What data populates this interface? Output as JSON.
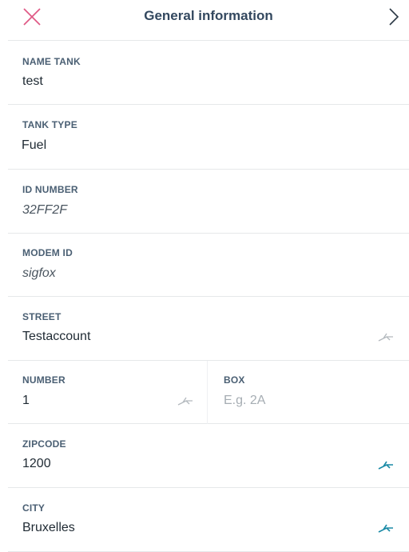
{
  "header": {
    "title": "General information",
    "close_icon": "close-icon",
    "next_icon": "chevron-right-icon"
  },
  "fields": {
    "name_tank": {
      "label": "NAME TANK",
      "value": "test"
    },
    "tank_type": {
      "label": "TANK TYPE",
      "value": "Fuel"
    },
    "id_number": {
      "label": "ID NUMBER",
      "value": "32FF2F"
    },
    "modem_id": {
      "label": "MODEM ID",
      "value": "sigfox"
    },
    "street": {
      "label": "STREET",
      "value": "Testaccount"
    },
    "number": {
      "label": "NUMBER",
      "value": "1"
    },
    "box": {
      "label": "BOX",
      "placeholder": "E.g. 2A"
    },
    "zipcode": {
      "label": "ZIPCODE",
      "value": "1200"
    },
    "city": {
      "label": "CITY",
      "value": "Bruxelles"
    }
  },
  "colors": {
    "close_icon": "#e05a86",
    "title": "#33485f",
    "edit_icon_active": "#1a8aa6",
    "edit_icon_inactive": "#b3b9be",
    "divider": "#e6e8ea"
  }
}
